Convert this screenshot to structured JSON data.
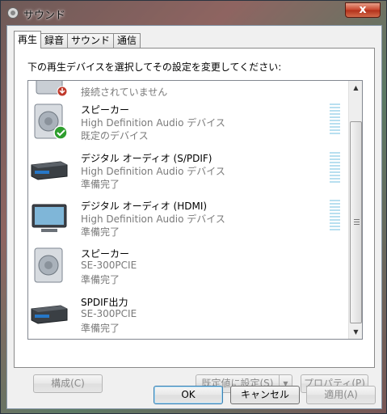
{
  "window": {
    "title": "サウンド",
    "close_label": "x"
  },
  "tabs": [
    {
      "label": "再生",
      "active": true
    },
    {
      "label": "録音",
      "active": false
    },
    {
      "label": "サウンド",
      "active": false
    },
    {
      "label": "通信",
      "active": false
    }
  ],
  "instruction": "下の再生デバイスを選択してその設定を変更してください:",
  "devices": [
    {
      "name": "",
      "description": "",
      "status": "接続されていません",
      "icon": "speaker-disconnected-icon"
    },
    {
      "name": "スピーカー",
      "description": "High Definition Audio デバイス",
      "status": "既定のデバイス",
      "icon": "speaker-icon",
      "default": true
    },
    {
      "name": "デジタル オーディオ (S/PDIF)",
      "description": "High Definition Audio デバイス",
      "status": "準備完了",
      "icon": "digital-receiver-icon"
    },
    {
      "name": "デジタル オーディオ (HDMI)",
      "description": "High Definition Audio デバイス",
      "status": "準備完了",
      "icon": "monitor-icon"
    },
    {
      "name": "スピーカー",
      "description": "SE-300PCIE",
      "status": "準備完了",
      "icon": "speaker-icon"
    },
    {
      "name": "SPDIF出力",
      "description": "SE-300PCIE",
      "status": "準備完了",
      "icon": "digital-receiver-icon"
    }
  ],
  "buttons": {
    "configure": "構成(C)",
    "set_default": "既定値に設定(S)",
    "properties": "プロパティ(P)",
    "ok": "OK",
    "cancel": "キャンセル",
    "apply": "適用(A)"
  },
  "colors": {
    "default_check": "#2e9e2e",
    "meter": "#b8dff0"
  }
}
